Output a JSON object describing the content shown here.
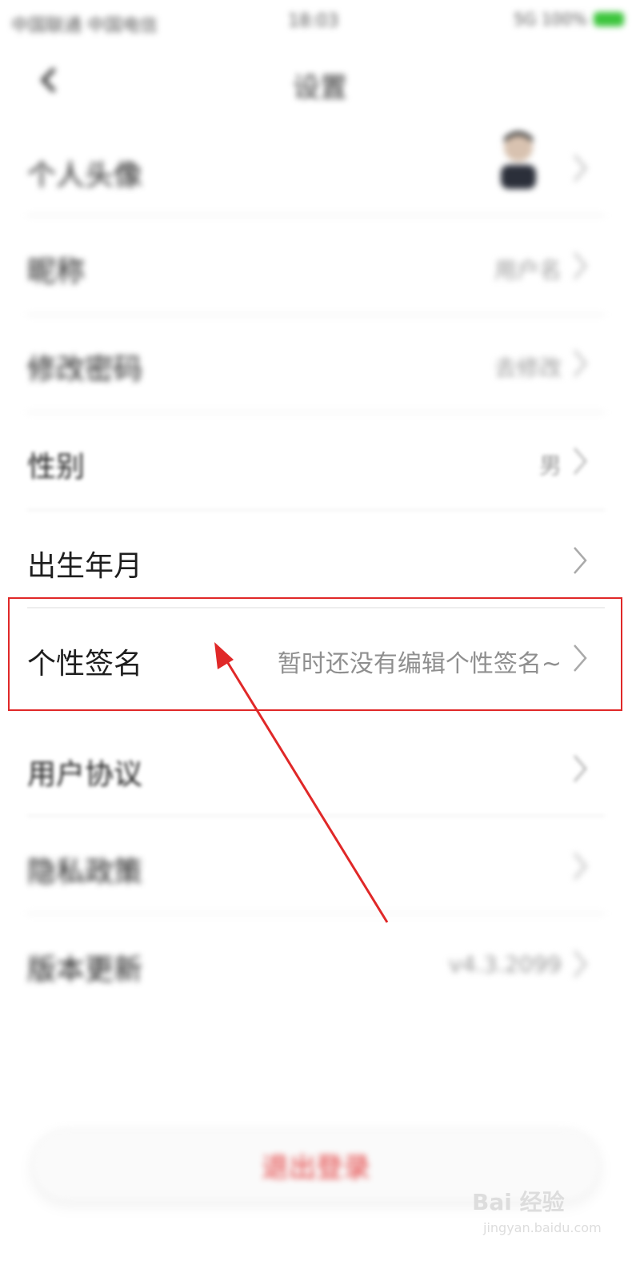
{
  "status_bar": {
    "carrier": "中国联通 中国电信",
    "time": "18:03",
    "signal": "5G 100%"
  },
  "nav": {
    "title": "设置",
    "back_icon": "back-arrow-icon"
  },
  "rows": [
    {
      "label": "个人头像",
      "value": "",
      "blurred": true,
      "avatar": true
    },
    {
      "label": "昵称",
      "value": "用户名",
      "blurred": true
    },
    {
      "label": "修改密码",
      "value": "去修改",
      "blurred": true
    },
    {
      "label": "性别",
      "value": "男",
      "blurred": true
    },
    {
      "label": "出生年月",
      "value": "",
      "blurred": false
    },
    {
      "label": "个性签名",
      "value": "暂时还没有编辑个性签名~",
      "blurred": false
    },
    {
      "label": "用户协议",
      "value": "",
      "blurred": "soft"
    },
    {
      "label": "隐私政策",
      "value": "",
      "blurred": true
    },
    {
      "label": "版本更新",
      "value": "v4.3.2099",
      "blurred": true
    }
  ],
  "logout": {
    "label": "退出登录"
  },
  "watermark": {
    "logo": "Bai 经验",
    "sub": "jingyan.baidu.com"
  },
  "colors": {
    "highlight": "#e02828",
    "logout_text": "#e23c3c",
    "divider": "#eeeeee"
  }
}
